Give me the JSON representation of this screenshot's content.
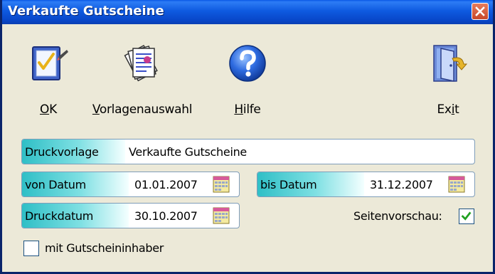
{
  "window": {
    "title": "Verkaufte Gutscheine"
  },
  "toolbar": {
    "ok_label": "OK",
    "ok_access": "O",
    "ok_rest": "K",
    "template_label": "Vorlagenauswahl",
    "template_access": "V",
    "template_rest": "orlagenauswahl",
    "help_label": "Hilfe",
    "help_access": "H",
    "help_rest": "ilfe",
    "exit_label": "Exit",
    "exit_pre": "Ex",
    "exit_access": "i",
    "exit_rest": "t"
  },
  "form": {
    "template": {
      "label": "Druckvorlage",
      "value": "Verkaufte Gutscheine"
    },
    "from_date": {
      "label": "von Datum",
      "value": "01.01.2007"
    },
    "to_date": {
      "label": "bis Datum",
      "value": "31.12.2007"
    },
    "print_date": {
      "label": "Druckdatum",
      "value": "30.10.2007"
    },
    "preview": {
      "label": "Seitenvorschau:",
      "checked": true
    },
    "with_owner": {
      "label": "mit Gutscheininhaber",
      "checked": false
    }
  },
  "colors": {
    "titlebar": "#0A58E6",
    "label_gradient_start": "#2FBFC6",
    "window_bg": "#ECE9D8"
  }
}
